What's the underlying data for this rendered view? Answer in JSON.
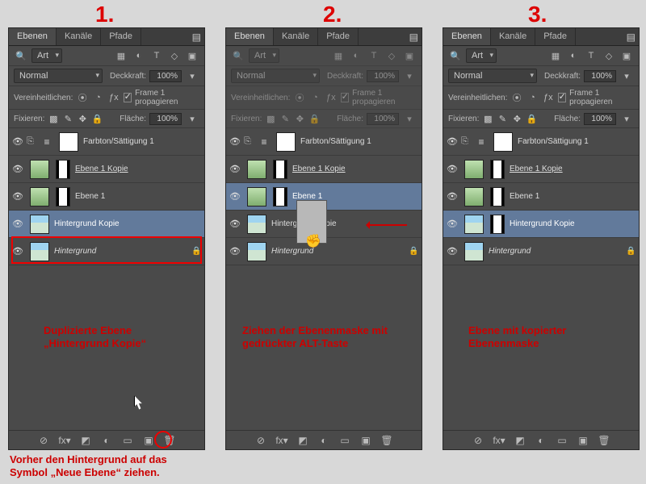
{
  "step_labels": [
    "1.",
    "2.",
    "3."
  ],
  "panel": {
    "tabs": [
      "Ebenen",
      "Kanäle",
      "Pfade"
    ],
    "search_dd": "Art",
    "blend_mode": "Normal",
    "opacity_label": "Deckkraft:",
    "opacity_value": "100%",
    "unify_label": "Vereinheitlichen:",
    "propagate_label": "Frame 1 propagieren",
    "lock_label": "Fixieren:",
    "fill_label": "Fläche:",
    "fill_value": "100%",
    "layers_p1": [
      {
        "name": "Farbton/Sättigung 1",
        "selected": false,
        "kind": "adj"
      },
      {
        "name": "Ebene 1 Kopie",
        "selected": false,
        "kind": "img1",
        "u": true
      },
      {
        "name": "Ebene 1",
        "selected": false,
        "kind": "img1"
      },
      {
        "name": "Hintergrund Kopie",
        "selected": true,
        "kind": "img2"
      },
      {
        "name": "Hintergrund",
        "selected": false,
        "kind": "img2",
        "ital": true,
        "locked": true
      }
    ],
    "layers_p2": [
      {
        "name": "Farbton/Sättigung 1",
        "selected": false,
        "kind": "adj"
      },
      {
        "name": "Ebene 1 Kopie",
        "selected": false,
        "kind": "img1",
        "u": true
      },
      {
        "name": "Ebene 1",
        "selected": true,
        "kind": "img1"
      },
      {
        "name": "Hintergrund Kopie",
        "selected": false,
        "kind": "img2"
      },
      {
        "name": "Hintergrund",
        "selected": false,
        "kind": "img2",
        "ital": true,
        "locked": true
      }
    ],
    "layers_p3": [
      {
        "name": "Farbton/Sättigung 1",
        "selected": false,
        "kind": "adj"
      },
      {
        "name": "Ebene 1 Kopie",
        "selected": false,
        "kind": "img1",
        "u": true
      },
      {
        "name": "Ebene 1",
        "selected": false,
        "kind": "img1"
      },
      {
        "name": "Hintergrund Kopie",
        "selected": true,
        "kind": "img2",
        "mask": true
      },
      {
        "name": "Hintergrund",
        "selected": false,
        "kind": "img2",
        "ital": true,
        "locked": true
      }
    ],
    "footer_icons": [
      "⊘",
      "fx▾",
      "◩",
      "◐",
      "▭",
      "▣",
      "🗑"
    ]
  },
  "captions": {
    "p1": "Duplizierte Ebene\n„Hintergrund Kopie“",
    "p2": "Ziehen der Ebenenmaske mit\ngedrückter ALT-Taste",
    "p3": "Ebene mit kopierter\nEbenenmaske",
    "bottom": "Vorher den Hintergrund auf das\nSymbol „Neue Ebene“ ziehen."
  }
}
